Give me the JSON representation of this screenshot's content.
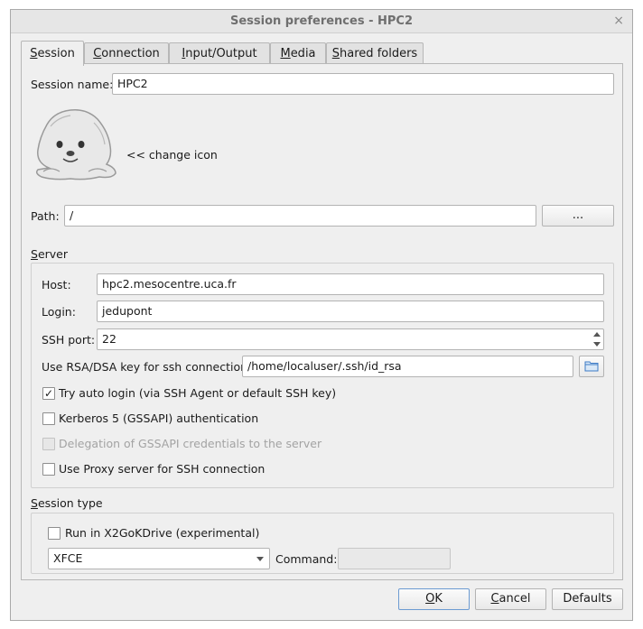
{
  "window": {
    "title": "Session preferences - HPC2",
    "close_glyph": "×"
  },
  "tabs": [
    {
      "first": "S",
      "rest": "ession",
      "active": true
    },
    {
      "first": "C",
      "rest": "onnection"
    },
    {
      "first": "I",
      "rest": "nput/Output"
    },
    {
      "first": "M",
      "rest": "edia"
    },
    {
      "first": "S",
      "rest": "hared folders"
    }
  ],
  "session": {
    "name_label": "Session name:",
    "name_value": "HPC2",
    "change_icon_label": "<< change icon",
    "path_label": "Path:",
    "path_value": "/",
    "path_browse_label": "..."
  },
  "server": {
    "group_first": "S",
    "group_rest": "erver",
    "host_label": "Host:",
    "host_value": "hpc2.mesocentre.uca.fr",
    "login_label": "Login:",
    "login_value": "jedupont",
    "port_label": "SSH port:",
    "port_value": "22",
    "key_label": "Use RSA/DSA key for ssh connection:",
    "key_value": "/home/localuser/.ssh/id_rsa",
    "auto_login_label": "Try auto login (via SSH Agent or default SSH key)",
    "auto_login_checked": true,
    "check_glyph": "✓",
    "kerberos_label": "Kerberos 5 (GSSAPI) authentication",
    "delegation_label": "Delegation of GSSAPI credentials to the server",
    "proxy_label": "Use Proxy server for SSH connection"
  },
  "session_type": {
    "group_first": "S",
    "group_rest": "ession type",
    "x2gokdrive_label": "Run in X2GoKDrive (experimental)",
    "type_value": "XFCE",
    "command_label": "Command:",
    "command_value": ""
  },
  "footer": {
    "ok_first": "O",
    "ok_rest": "K",
    "cancel_first": "C",
    "cancel_rest": "ancel",
    "defaults_label": "Defaults"
  }
}
